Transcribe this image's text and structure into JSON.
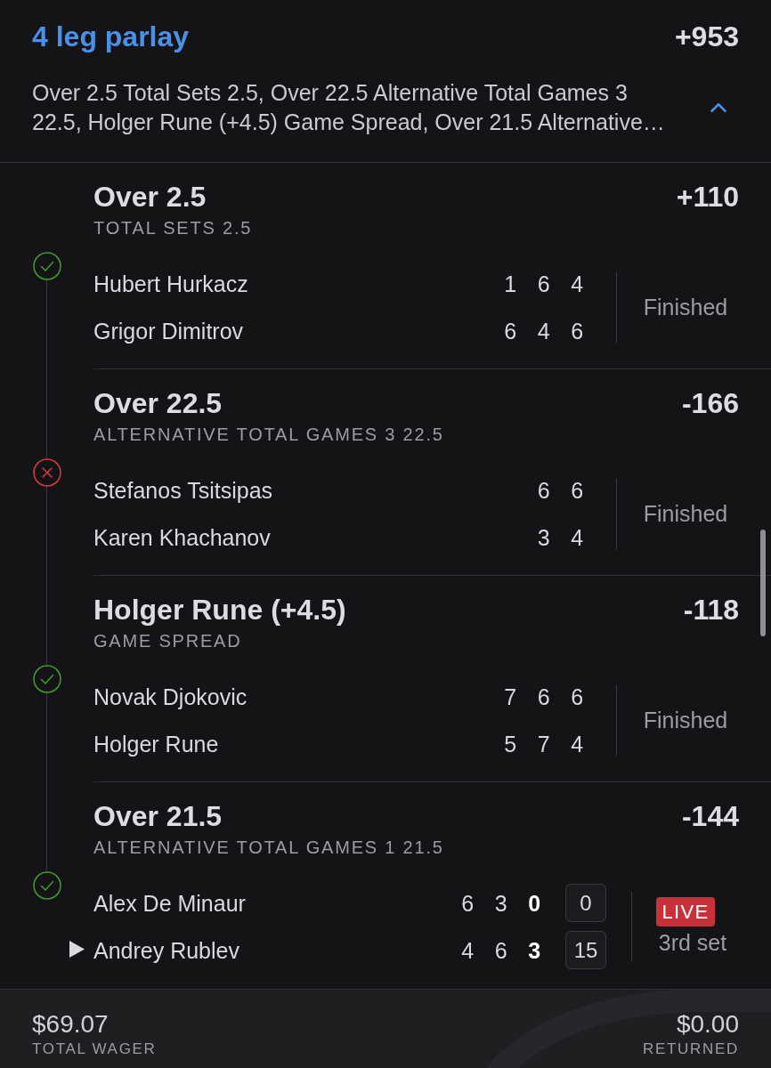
{
  "parlay": {
    "title": "4 leg parlay",
    "odds": "+953",
    "summary": "Over 2.5 Total Sets 2.5, Over 22.5 Alternative Total Games 3 22.5, Holger Rune (+4.5) Game Spread, Over 21.5 Alternative…",
    "expanded": true
  },
  "legs": [
    {
      "selection": "Over 2.5",
      "market": "TOTAL SETS 2.5",
      "odds": "+110",
      "won": true,
      "status": {
        "kind": "finished",
        "label": "Finished"
      },
      "players": [
        {
          "name": "Hubert Hurkacz",
          "serving": false,
          "sets": [
            "1",
            "6",
            "4"
          ]
        },
        {
          "name": "Grigor Dimitrov",
          "serving": false,
          "sets": [
            "6",
            "4",
            "6"
          ]
        }
      ]
    },
    {
      "selection": "Over 22.5",
      "market": "ALTERNATIVE TOTAL GAMES 3 22.5",
      "odds": "-166",
      "won": false,
      "status": {
        "kind": "finished",
        "label": "Finished"
      },
      "players": [
        {
          "name": "Stefanos Tsitsipas",
          "serving": false,
          "sets": [
            "6",
            "6"
          ]
        },
        {
          "name": "Karen Khachanov",
          "serving": false,
          "sets": [
            "3",
            "4"
          ]
        }
      ]
    },
    {
      "selection": "Holger Rune (+4.5)",
      "market": "GAME SPREAD",
      "odds": "-118",
      "won": true,
      "status": {
        "kind": "finished",
        "label": "Finished"
      },
      "players": [
        {
          "name": "Novak Djokovic",
          "serving": false,
          "sets": [
            "7",
            "6",
            "6"
          ]
        },
        {
          "name": "Holger Rune",
          "serving": false,
          "sets": [
            "5",
            "7",
            "4"
          ]
        }
      ]
    },
    {
      "selection": "Over 21.5",
      "market": "ALTERNATIVE TOTAL GAMES 1 21.5",
      "odds": "-144",
      "won": true,
      "status": {
        "kind": "live",
        "badge": "LIVE",
        "label": "3rd set"
      },
      "players": [
        {
          "name": "Alex De Minaur",
          "serving": false,
          "sets": [
            "6",
            "3"
          ],
          "current_set": "0",
          "points": "0"
        },
        {
          "name": "Andrey Rublev",
          "serving": true,
          "sets": [
            "4",
            "6"
          ],
          "current_set": "3",
          "points": "15"
        }
      ]
    }
  ],
  "footer": {
    "wager": {
      "amount": "$69.07",
      "label": "TOTAL WAGER"
    },
    "returned": {
      "amount": "$0.00",
      "label": "RETURNED"
    }
  }
}
